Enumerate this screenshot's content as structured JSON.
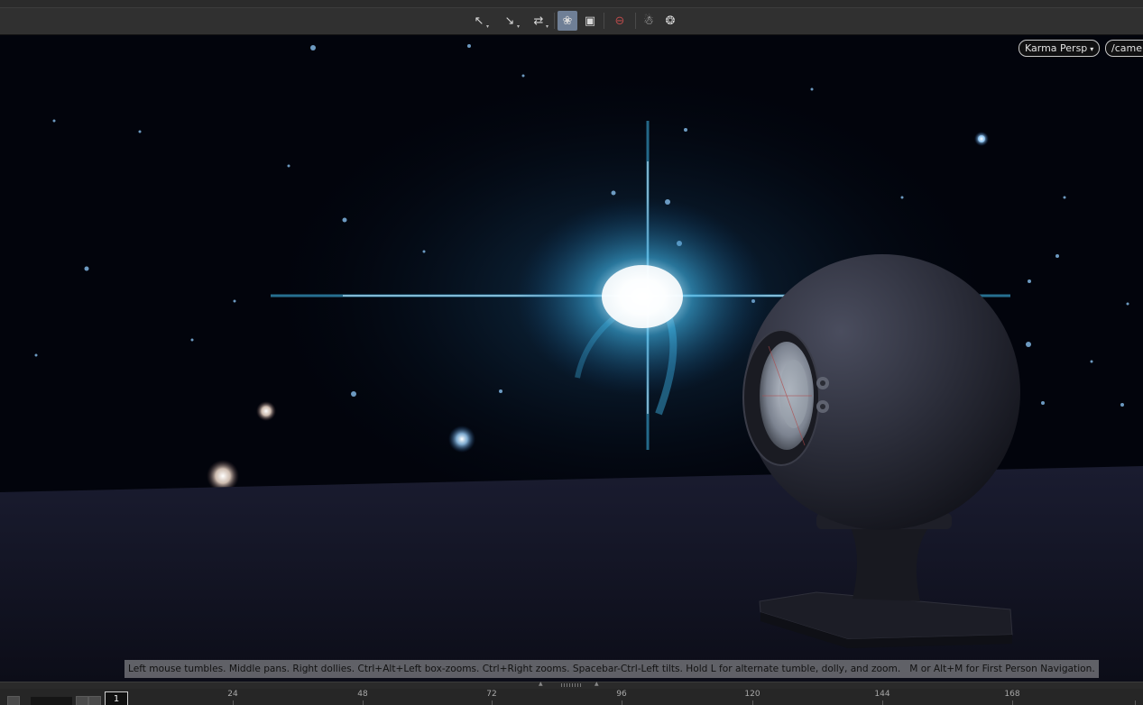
{
  "toolbar": {
    "tools": [
      {
        "name": "select-tool",
        "glyph": "↖",
        "caret": "▾"
      },
      {
        "name": "transform-tool",
        "glyph": "↘",
        "caret": "▾"
      },
      {
        "name": "handle-tool",
        "glyph": "⇄",
        "caret": "▾"
      },
      {
        "name": "camera-view-tool",
        "glyph": "❀",
        "caret": ""
      },
      {
        "name": "lights-tool",
        "glyph": "▣",
        "caret": ""
      },
      {
        "name": "stop-render-tool",
        "glyph": "⊖",
        "caret": ""
      },
      {
        "name": "snapshot-tool",
        "glyph": "☃",
        "caret": ""
      },
      {
        "name": "render-settings-tool",
        "glyph": "❂",
        "caret": ""
      }
    ]
  },
  "viewport": {
    "renderer_label": "Karma  Persp",
    "renderer_caret": "▾",
    "camera_label": "/camer",
    "hint_part1": "Left mouse tumbles. Middle pans. Right dollies. Ctrl+Alt+Left box-zooms. Ctrl+Right zooms. Spacebar-Ctrl-Left tilts. Hold L for alternate tumble, dolly, and zoom.",
    "hint_part2": "M or Alt+M for First Person Navigation.",
    "colors": {
      "star_core": "#ffffff",
      "star_glow": "#3fb6e8",
      "sky": "#02040c",
      "floor": "#14162a"
    }
  },
  "timeline": {
    "current_frame": "1",
    "ticks": [
      "24",
      "48",
      "72",
      "96",
      "120",
      "144",
      "168"
    ]
  }
}
